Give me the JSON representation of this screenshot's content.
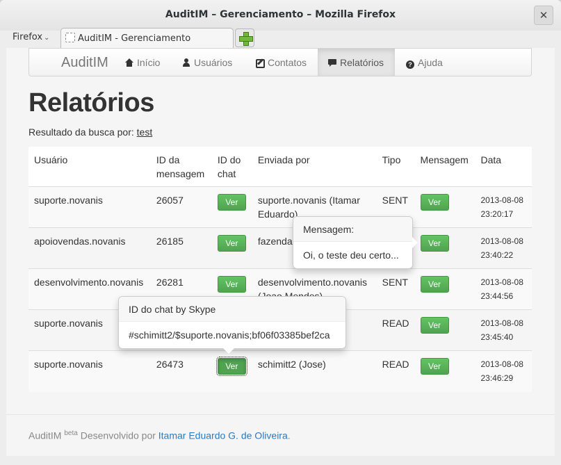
{
  "window": {
    "title": "AuditIM – Gerenciamento – Mozilla Firefox",
    "close_icon": "close-icon"
  },
  "tabbar": {
    "firefox_menu": "Firefox",
    "tab_label": "AuditIM - Gerenciamento",
    "new_tab_icon": "plus-icon"
  },
  "navbar": {
    "brand": "AuditIM",
    "items": [
      {
        "label": "Início",
        "icon": "home-icon"
      },
      {
        "label": "Usuários",
        "icon": "user-icon"
      },
      {
        "label": "Contatos",
        "icon": "edit-icon"
      },
      {
        "label": "Relatórios",
        "icon": "comment-icon",
        "active": true
      },
      {
        "label": "Ajuda",
        "icon": "help-icon"
      }
    ]
  },
  "page": {
    "title": "Relatórios",
    "search_prefix": "Resultado da busca por:",
    "search_term": "test"
  },
  "table": {
    "headers": [
      "Usuário",
      "ID da mensagem",
      "ID do chat",
      "Enviada por",
      "Tipo",
      "Mensagem",
      "Data"
    ],
    "button_label": "Ver",
    "rows": [
      {
        "usuario": "suporte.novanis",
        "id": "26057",
        "enviada": "suporte.novanis (Itamar Eduardo)",
        "tipo": "SENT",
        "date": "2013-08-08",
        "time": "23:20:17"
      },
      {
        "usuario": "apoiovendas.novanis",
        "id": "26185",
        "enviada": "fazenda",
        "tipo": "",
        "date": "2013-08-08",
        "time": "23:40:22"
      },
      {
        "usuario": "desenvolvimento.novanis",
        "id": "26281",
        "enviada": "desenvolvimento.novanis (Joao Mendes)",
        "tipo": "SENT",
        "date": "2013-08-08",
        "time": "23:44:56"
      },
      {
        "usuario": "suporte.novanis",
        "id": "",
        "enviada": "",
        "tipo": "READ",
        "date": "2013-08-08",
        "time": "23:45:40"
      },
      {
        "usuario": "suporte.novanis",
        "id": "26473",
        "enviada": "schimitt2 (Jose)",
        "tipo": "READ",
        "date": "2013-08-08",
        "time": "23:46:29"
      }
    ]
  },
  "popover_message": {
    "title": "Mensagem:",
    "content": "Oi, o teste deu certo..."
  },
  "popover_chat": {
    "title": "ID do chat by Skype",
    "content": "#schimitt2/$suporte.novanis;bf06f03385bef2ca"
  },
  "footer": {
    "brand": "AuditIM",
    "badge": "beta",
    "text": "Desenvolvido por",
    "author": "Itamar Eduardo G. de Oliveira",
    "suffix": "."
  }
}
